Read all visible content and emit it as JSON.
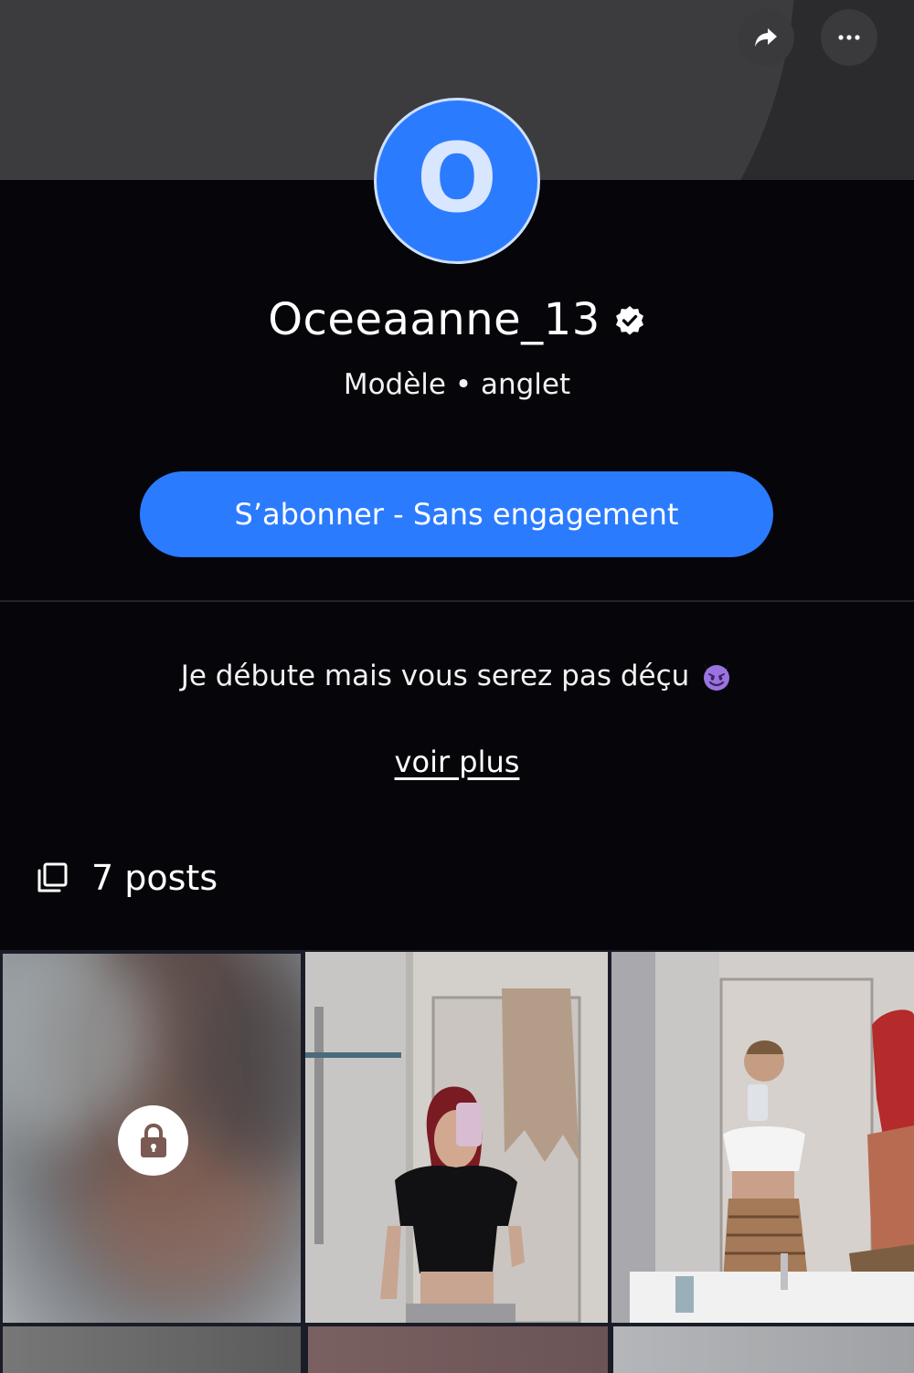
{
  "header": {
    "share_icon": "share-arrow-icon",
    "more_icon": "more-dots-icon"
  },
  "profile": {
    "avatar_letter": "O",
    "name": "Oceeaanne_13",
    "verified": true,
    "subtitle": "Modèle • anglet",
    "subscribe_label": "S’abonner - Sans engagement",
    "bio": "Je débute mais vous serez pas déçu",
    "bio_emoji": "smiling-devil-emoji",
    "see_more_label": "voir plus"
  },
  "posts": {
    "icon": "gallery-icon",
    "count_label": "7 posts",
    "items": [
      {
        "locked": true,
        "lock_icon": "lock-icon"
      },
      {
        "locked": false
      },
      {
        "locked": false
      },
      {
        "locked": true
      },
      {
        "locked": true
      },
      {
        "locked": true
      }
    ]
  },
  "colors": {
    "background": "#05050a",
    "accent": "#2b7bff",
    "banner": "#2b2b2e"
  }
}
